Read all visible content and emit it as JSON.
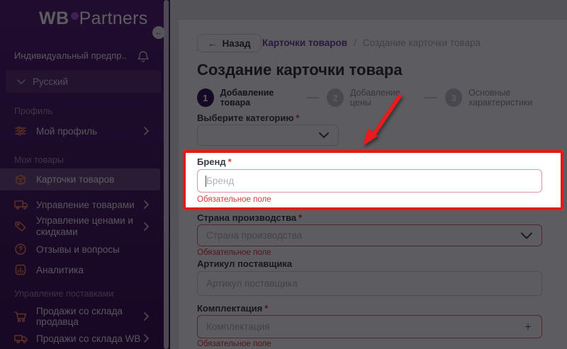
{
  "colors": {
    "sidebar_purple": "#4f1b71",
    "icon_coral": "#ff8255",
    "highlight_red": "#e51a17",
    "error_red": "#d23c3c",
    "step_active_purple": "#31125a",
    "breadcrumb_purple": "#6f3e9e",
    "logo_dot": "#b44fe0"
  },
  "sidebar": {
    "logo": {
      "wb": "WB",
      "partners": "Partners"
    },
    "account": "Индивидуальный предпр...",
    "language": "Русский",
    "sections": [
      {
        "title": "Профиль",
        "items": [
          {
            "label": "Мой профиль"
          }
        ]
      },
      {
        "title": "Мои товары",
        "items": [
          {
            "label": "Карточки товаров"
          },
          {
            "label": "Управление товарами"
          },
          {
            "label": "Управление ценами и скидками"
          },
          {
            "label": "Отзывы и вопросы"
          },
          {
            "label": "Аналитика"
          }
        ]
      },
      {
        "title": "Управление поставками",
        "items": [
          {
            "label": "Продажи со склада продавца"
          },
          {
            "label": "Продажи со склада WB"
          }
        ]
      }
    ]
  },
  "header": {
    "back_label": "Назад",
    "back_arrow": "←",
    "breadcrumb": {
      "link": "Карточки товаров",
      "separator": "/",
      "current": "Создание карточки товара"
    },
    "title": "Создание карточки товара"
  },
  "steps": [
    {
      "number": "1",
      "label": "Добавление товара"
    },
    {
      "number": "2",
      "label": "Добавление цены"
    },
    {
      "number": "3",
      "label": "Основные характеристики"
    }
  ],
  "form": {
    "category": {
      "label": "Выберите категорию",
      "required": "*"
    },
    "brand": {
      "label": "Бренд",
      "required": "*",
      "placeholder": "Бренд",
      "error": "Обязательное поле"
    },
    "country": {
      "label": "Страна производства",
      "required": "*",
      "placeholder": "Страна производства",
      "error": "Обязательное поле"
    },
    "article": {
      "label": "Артикул поставщика",
      "placeholder": "Артикул поставщика"
    },
    "kit": {
      "label": "Комплектация",
      "required": "*",
      "placeholder": "Комплектация",
      "error": "Обязательное поле",
      "plus": "+"
    }
  }
}
